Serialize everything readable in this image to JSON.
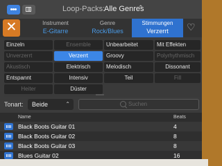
{
  "toolbar": {
    "loop_packs_label": "Loop-Packs:",
    "loop_packs_value": "Alle Genres"
  },
  "tabs": [
    {
      "title": "Instrument",
      "value": "E-Gitarre"
    },
    {
      "title": "Genre",
      "value": "Rock/Blues"
    },
    {
      "title": "Stimmungen",
      "value": "Verzerrt"
    }
  ],
  "chips": [
    [
      "Einzeln",
      "Ensemble",
      "Unbearbeitet",
      "Mit Effekten"
    ],
    [
      "Unverzerrt",
      "Verzerrt",
      "Groovy",
      "Polyrhythmisch"
    ],
    [
      "Akustisch",
      "Elektrisch",
      "Melodisch",
      "Dissonant"
    ],
    [
      "Entspannt",
      "Intensiv",
      "Teil",
      "Fill"
    ],
    [
      "Heiter",
      "Düster"
    ]
  ],
  "filter": {
    "tonart_label": "Tonart:",
    "tonart_value": "Beide",
    "search_placeholder": "Suchen"
  },
  "table": {
    "headers": {
      "name": "Name",
      "beats": "Beats"
    },
    "rows": [
      {
        "name": "Black Boots Guitar 01",
        "beats": "4"
      },
      {
        "name": "Black Boots Guitar 02",
        "beats": "8"
      },
      {
        "name": "Black Boots Guitar 03",
        "beats": "8"
      },
      {
        "name": "Blues Guitar 02",
        "beats": "16"
      }
    ]
  },
  "colors": {
    "accent": "#2f72cf",
    "close": "#d77a24",
    "frame": "#b0782a"
  },
  "icons": [
    "loops-icon",
    "grid-view-icon",
    "close-icon",
    "heart-icon",
    "search-icon",
    "waveform-icon"
  ]
}
